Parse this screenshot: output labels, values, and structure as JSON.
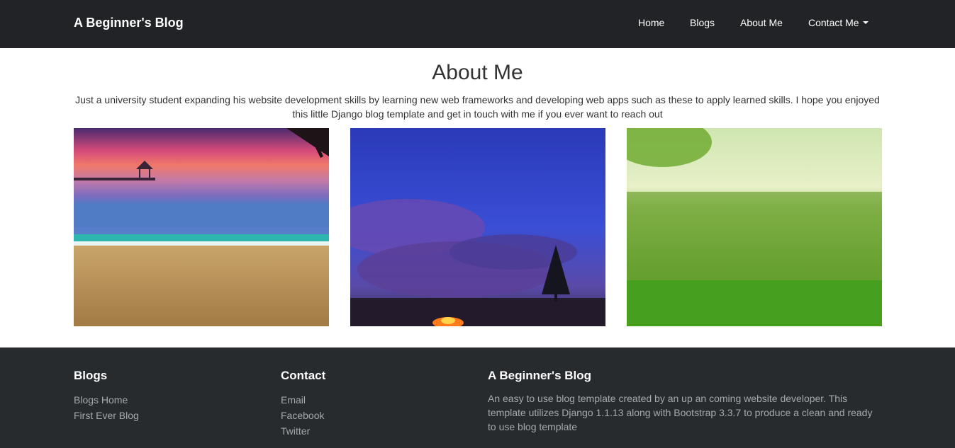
{
  "navbar": {
    "brand": "A Beginner's Blog",
    "links": [
      "Home",
      "Blogs",
      "About Me",
      "Contact Me"
    ]
  },
  "main": {
    "title": "About Me",
    "description": "Just a university student expanding his website development skills by learning new web frameworks and developing web apps such as these to apply learned skills. I hope you enjoyed this little Django blog template and get in touch with me if you ever want to reach out",
    "images": [
      "beach-sunset-photo",
      "night-sky-campfire-photo",
      "green-grass-field-photo"
    ]
  },
  "footer": {
    "blogs": {
      "heading": "Blogs",
      "links": [
        "Blogs Home",
        "First Ever Blog"
      ]
    },
    "contact": {
      "heading": "Contact",
      "links": [
        "Email",
        "Facebook",
        "Twitter"
      ]
    },
    "about": {
      "heading": "A Beginner's Blog",
      "text": "An easy to use blog template created by an up an coming website developer. This template utilizes Django 1.1.13 along with Bootstrap 3.3.7 to produce a clean and ready to use blog template"
    }
  },
  "colors": {
    "navbar_bg": "#222326",
    "footer_bg": "#272b2e",
    "footer_text": "#a6a9ab"
  }
}
